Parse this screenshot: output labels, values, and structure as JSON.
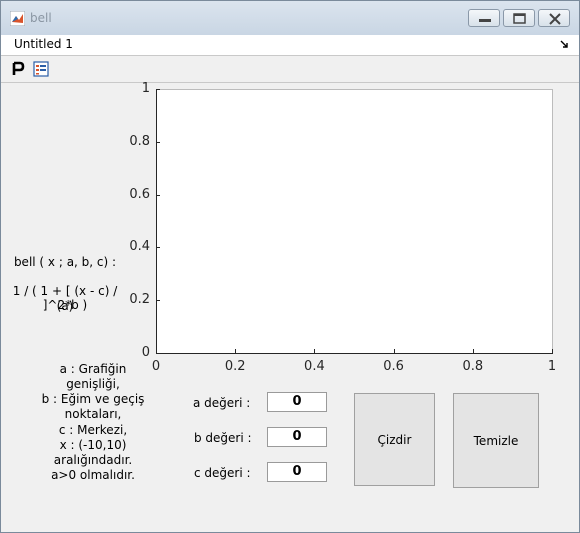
{
  "window": {
    "title": "bell",
    "controls": [
      "minimize-icon",
      "maximize-icon",
      "close-icon"
    ]
  },
  "tab": {
    "label": "Untitled 1",
    "dock_icon": "undock-arrow-icon"
  },
  "toolbar": {
    "items": [
      "property-inspector-icon",
      "layout-grid-icon"
    ]
  },
  "formula": {
    "line1": "bell ( x ; a, b, c) :",
    "line2": "1 / ( 1 + [ (x - c) / (a)",
    "line3": "]^2*b )"
  },
  "notes": [
    "a : Grafiğin",
    "genişliği,",
    "b : Eğim ve geçiş",
    "noktaları,",
    "c : Merkezi,",
    "x : (-10,10)",
    "aralığındadır.",
    "a>0 olmalıdır."
  ],
  "inputs": {
    "a": {
      "label": "a değeri :",
      "value": "0"
    },
    "b": {
      "label": "b değeri :",
      "value": "0"
    },
    "c": {
      "label": "c değeri :",
      "value": "0"
    }
  },
  "buttons": {
    "draw": "Çizdir",
    "clear": "Temizle"
  },
  "chart_data": {
    "type": "line",
    "series": [],
    "xlim": [
      0,
      1
    ],
    "ylim": [
      0,
      1
    ],
    "xticks": [
      "0",
      "0.2",
      "0.4",
      "0.6",
      "0.8",
      "1"
    ],
    "yticks": [
      "0",
      "0.2",
      "0.4",
      "0.6",
      "0.8",
      "1"
    ],
    "grid": false
  }
}
